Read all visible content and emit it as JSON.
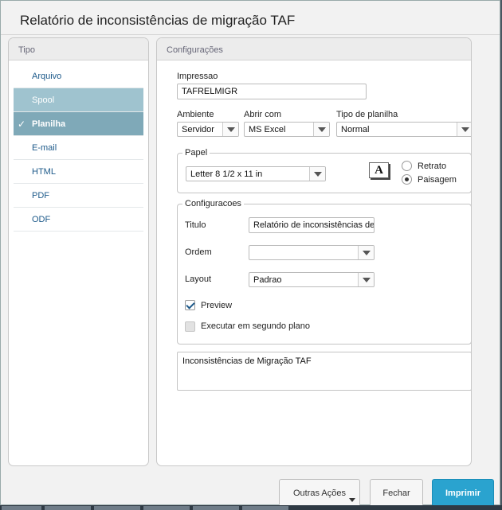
{
  "window": {
    "title": "Relatório de inconsistências de migração TAF"
  },
  "tipo": {
    "header": "Tipo",
    "items": [
      {
        "label": "Arquivo"
      },
      {
        "label": "Spool"
      },
      {
        "label": "Planilha",
        "check": "✓"
      },
      {
        "label": "E-mail"
      },
      {
        "label": "HTML"
      },
      {
        "label": "PDF"
      },
      {
        "label": "ODF"
      }
    ],
    "selected": "Planilha"
  },
  "configuracoes": {
    "header": "Configurações",
    "impressao": {
      "label": "Impressao",
      "value": "TAFRELMIGR"
    },
    "ambiente": {
      "label": "Ambiente",
      "value": "Servidor"
    },
    "abrir_com": {
      "label": "Abrir com",
      "value": "MS Excel"
    },
    "tipo_planilha": {
      "label": "Tipo de planilha",
      "value": "Normal"
    },
    "papel": {
      "legend": "Papel",
      "size": "Letter 8 1/2 x 11 in",
      "font_icon": "A",
      "retrato": "Retrato",
      "paisagem": "Paisagem",
      "orientation": "Paisagem"
    },
    "grupo": {
      "legend": "Configuracoes",
      "titulo": {
        "label": "Titulo",
        "value": "Relatório de inconsistências de"
      },
      "ordem": {
        "label": "Ordem",
        "value": ""
      },
      "layout": {
        "label": "Layout",
        "value": "Padrao"
      },
      "preview": {
        "label": "Preview",
        "checked": true
      },
      "segundo_plano": {
        "label": "Executar em segundo plano",
        "checked": false,
        "enabled": false
      }
    },
    "descricao": "Inconsistências de Migração TAF"
  },
  "footer": {
    "outras_acoes": "Outras Ações",
    "fechar": "Fechar",
    "imprimir": "Imprimir"
  },
  "colors": {
    "accent": "#2aa3cf",
    "selected_item": "#7fa9b8",
    "hover_item": "#9fc3cf"
  }
}
